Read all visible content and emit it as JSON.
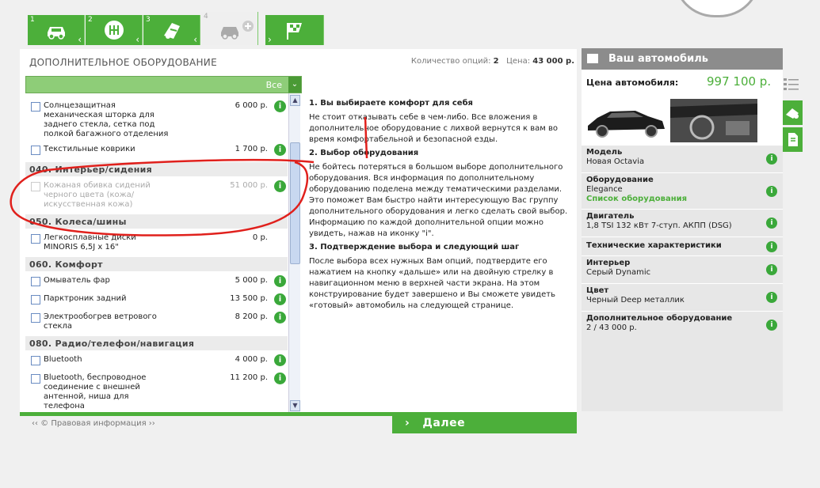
{
  "steps": [
    {
      "num": "1",
      "icon": "car-icon"
    },
    {
      "num": "2",
      "icon": "gearbox-icon"
    },
    {
      "num": "3",
      "icon": "paint-icon"
    },
    {
      "num": "4",
      "icon": "car-plus-icon"
    },
    {
      "num": "",
      "icon": "finish-flag-icon"
    }
  ],
  "title": "ДОПОЛНИТЕЛЬНОЕ ОБОРУДОВАНИЕ",
  "summary": {
    "count_label": "Количество опций:",
    "count": "2",
    "price_label": "Цена:",
    "price": "43 000 р."
  },
  "filter": {
    "value": "Все"
  },
  "list": {
    "i1": {
      "name": "Солнцезащитная механическая шторка для заднего стекла, сетка под полкой багажного отделения",
      "price": "6 000 р."
    },
    "i2": {
      "name": "Текстильные коврики",
      "price": "1 700 р."
    },
    "c1": "040. Интерьер/сидения",
    "i3": {
      "name": "Кожаная обивка сидений черного цвета (кожа/искусственная кожа)",
      "price": "51 000 р."
    },
    "c2": "050. Колеса/шины",
    "i4": {
      "name": "Легкосплавные диски MINORIS 6,5J x 16\"",
      "price": "0 р."
    },
    "c3": "060. Комфорт",
    "i5": {
      "name": "Омыватель фар",
      "price": "5 000 р."
    },
    "i6": {
      "name": "Парктроник задний",
      "price": "13 500 р."
    },
    "i7": {
      "name": "Электрообогрев ветрового стекла",
      "price": "8 200 р."
    },
    "c4": "080. Радио/телефон/навигация",
    "i8": {
      "name": "Bluetooth",
      "price": "4 000 р."
    },
    "i9": {
      "name": "Bluetooth, беспроводное соединение с внешней антенной, ниша для телефона",
      "price": "11 200 р."
    },
    "info": "i"
  },
  "help": {
    "h1": "1. Вы выбираете комфорт для себя",
    "p1": "Не стоит отказывать себе в чем-либо. Все вложения в дополнительное оборудование с лихвой вернутся к вам во время комфортабельной и безопасной езды.",
    "h2": "2. Выбор оборудования",
    "p2": "Не бойтесь потеряться в большом выборе дополнительного оборудования. Вся информация по дополнительному оборудованию поделена между тематическими разделами. Это поможет Вам быстро найти интересующую Вас группу дополнительного оборудования и легко сделать свой выбор. Информацию по каждой дополнительной опции можно увидеть, нажав на иконку \"i\".",
    "h3": "3. Подтверждение выбора и следующий шаг",
    "p3": "После выбора всех нужных Вам опций, подтвердите его нажатием на кнопку «дальше» или на двойную стрелку в навигационном меню в верхней части экрана. На этом конструирование будет завершено и Вы сможете увидеть «готовый» автомобиль на следующей странице."
  },
  "next": {
    "arrow": "›",
    "label": "Далее"
  },
  "legal": "‹‹ © Правовая информация ››",
  "car": {
    "header": "Ваш автомобиль",
    "price_label": "Цена автомобиля:",
    "price": "997 100 р.",
    "model_k": "Модель",
    "model_v": "Новая Octavia",
    "equip_k": "Оборудование",
    "equip_v": "Elegance",
    "equip_link": "Список оборудования",
    "engine_k": "Двигатель",
    "engine_v": "1,8 TSI 132 кВт 7-ступ. АКПП (DSG)",
    "tech_k": "Технические характеристики",
    "interior_k": "Интерьер",
    "interior_v": "Серый Dynamic",
    "color_k": "Цвет",
    "color_v": "Черный Deep металлик",
    "extra_k": "Дополнительное оборудование",
    "extra_v": "2 / 43 000 р."
  },
  "colors": {
    "accent": "#4caf3a",
    "annotation": "#e0201c"
  }
}
